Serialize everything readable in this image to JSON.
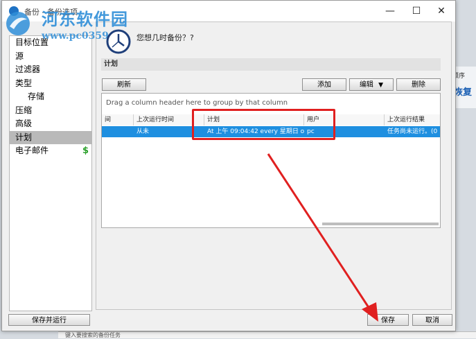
{
  "watermark": {
    "site_name": "河东软件园",
    "url": "www.pc0359.cn"
  },
  "window": {
    "title": "备份 - 备份选项",
    "minimize": "—",
    "maximize": "☐",
    "close": "✕"
  },
  "nav": {
    "items": [
      {
        "label": "目标位置"
      },
      {
        "label": "源"
      },
      {
        "label": "过滤器"
      },
      {
        "label": "类型"
      },
      {
        "label": "存储"
      },
      {
        "label": "压缩"
      },
      {
        "label": "高级"
      },
      {
        "label": "计划"
      },
      {
        "label": "电子邮件"
      }
    ],
    "save_and_run": "保存并运行"
  },
  "content": {
    "prompt": "您想几时备份？?",
    "section_title": "计划",
    "toolbar": {
      "refresh": "刷新",
      "add": "添加",
      "edit": "编辑",
      "delete": "删除"
    },
    "grid": {
      "group_hint": "Drag a column header here to group by that column",
      "columns": [
        "间",
        "上次运行时间",
        "计划",
        "用户",
        "上次运行结果"
      ],
      "row": {
        "last_run": "从未",
        "schedule": "At 上午 09:04:42 every 星期日 o",
        "user": "pc",
        "result": "任务尚未运行。(0"
      }
    }
  },
  "footer": {
    "save": "保存",
    "cancel": "取消"
  },
  "background": {
    "right_label": "顺序",
    "right_link": "恢复",
    "bottom_hint": "键入要搜索的备份任务"
  },
  "colors": {
    "selection": "#1e8fe0",
    "highlight_box": "#e02020",
    "nav_selected": "#b9b9b9",
    "watermark": "#2f8ed8"
  }
}
